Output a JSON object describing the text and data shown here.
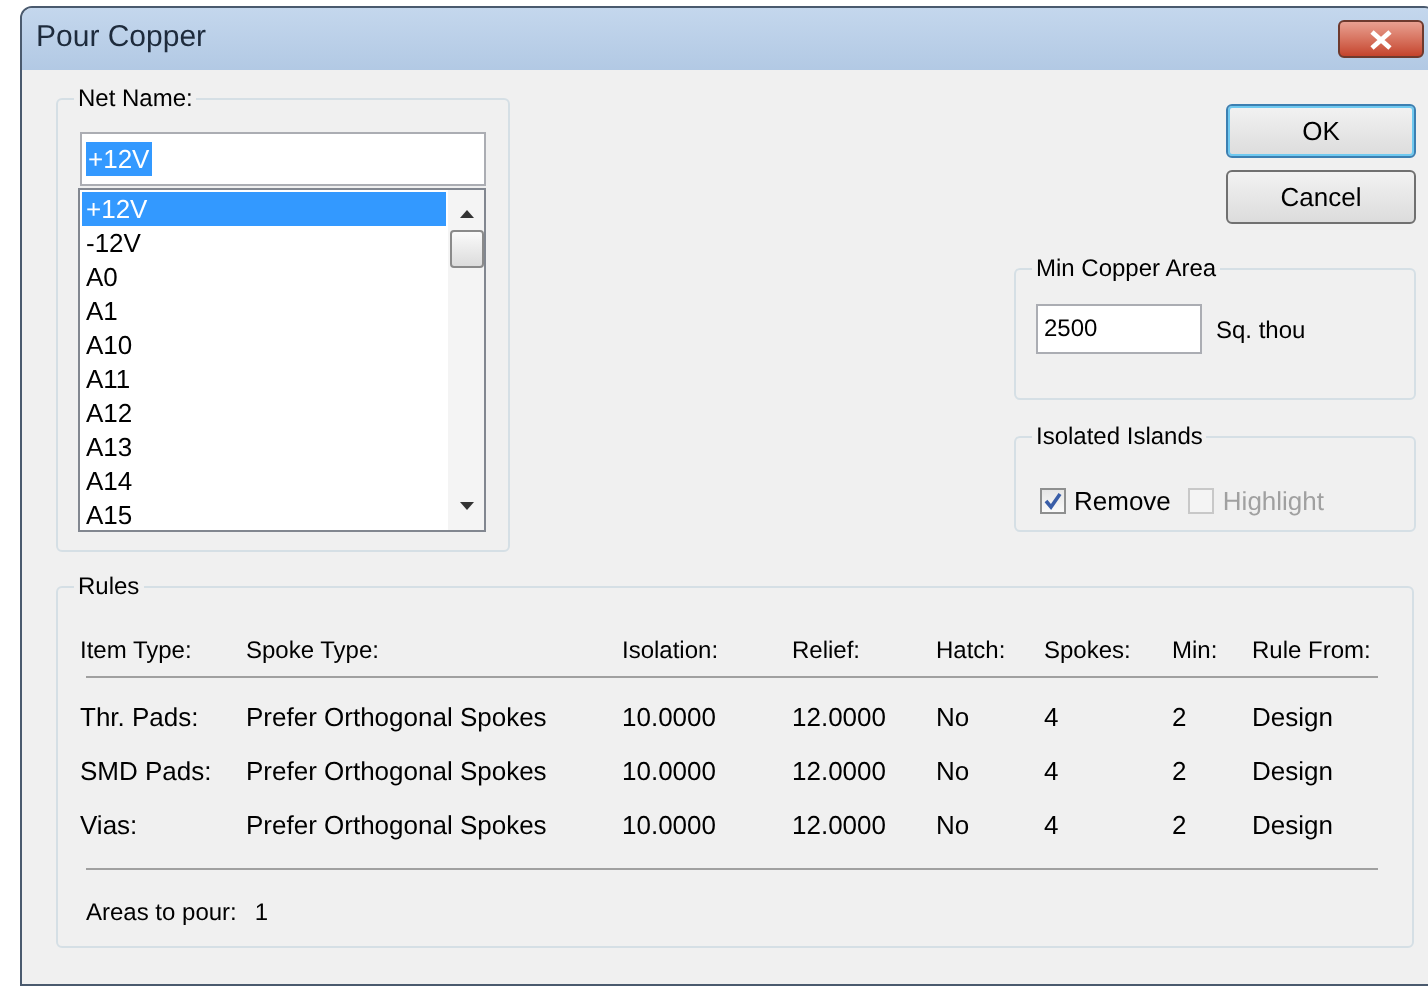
{
  "window": {
    "title": "Pour Copper"
  },
  "net_name": {
    "label": "Net Name:",
    "value": "+12V",
    "value_selected": true,
    "items": [
      {
        "label": "+12V",
        "selected": true
      },
      {
        "label": "-12V",
        "selected": false
      },
      {
        "label": "A0",
        "selected": false
      },
      {
        "label": "A1",
        "selected": false
      },
      {
        "label": "A10",
        "selected": false
      },
      {
        "label": "A11",
        "selected": false
      },
      {
        "label": "A12",
        "selected": false
      },
      {
        "label": "A13",
        "selected": false
      },
      {
        "label": "A14",
        "selected": false
      },
      {
        "label": "A15",
        "selected": false
      }
    ]
  },
  "buttons": [
    {
      "label": "OK",
      "default": true
    },
    {
      "label": "Cancel",
      "default": false
    }
  ],
  "min_copper_area": {
    "label": "Min Copper Area",
    "value": "2500",
    "unit": "Sq. thou"
  },
  "isolated_islands": {
    "label": "Isolated Islands",
    "options": [
      {
        "label": "Remove",
        "checked": true,
        "disabled": false
      },
      {
        "label": "Highlight",
        "checked": false,
        "disabled": true
      }
    ]
  },
  "rules": {
    "label": "Rules",
    "columns": [
      "Item Type:",
      "Spoke Type:",
      "Isolation:",
      "Relief:",
      "Hatch:",
      "Spokes:",
      "Min:",
      "Rule From:"
    ],
    "rows": [
      [
        "Thr. Pads:",
        "Prefer Orthogonal Spokes",
        "10.0000",
        "12.0000",
        "No",
        "4",
        "2",
        "Design"
      ],
      [
        "SMD Pads:",
        "Prefer Orthogonal Spokes",
        "10.0000",
        "12.0000",
        "No",
        "4",
        "2",
        "Design"
      ],
      [
        "Vias:",
        "Prefer Orthogonal Spokes",
        "10.0000",
        "12.0000",
        "No",
        "4",
        "2",
        "Design"
      ]
    ],
    "areas_label": "Areas to pour:",
    "areas_value": "1"
  }
}
